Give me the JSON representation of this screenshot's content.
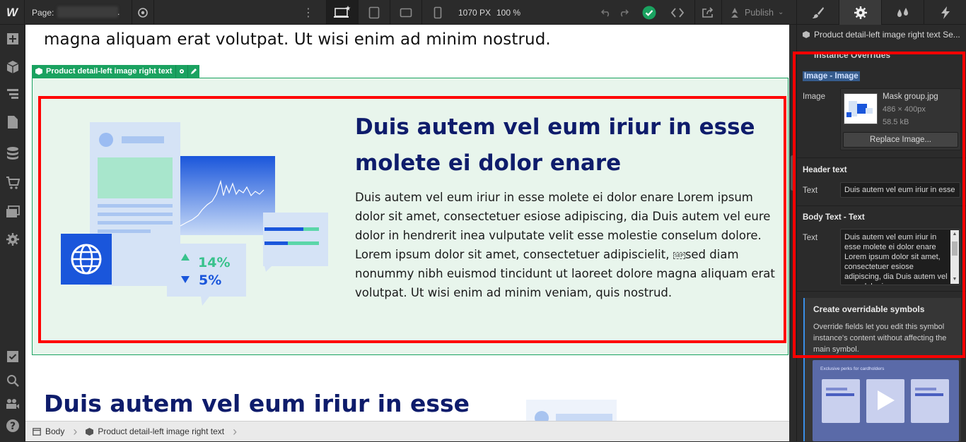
{
  "topbar": {
    "logo": "W",
    "page_label": "Page:",
    "page_name_dot": ".",
    "width_readout": "1070 PX",
    "zoom_readout": "100 %",
    "publish_label": "Publish"
  },
  "canvas": {
    "top_text": "magna aliquam erat volutpat. Ut wisi enim ad minim nostrud.",
    "symbol_tag": "Product detail-left image right text",
    "headline": "Duis autem vel eum iriur in esse molete ei dolor enare",
    "body_before_sep": "Duis autem vel eum iriur in esse molete ei dolor enare Lorem ipsum dolor sit amet, consectetuer esiose adipiscing,  dia Duis autem vel eure dolor in hendrerit inea vulputate velit esse molestie conselum dolore. Lorem ipsum dolor sit amet, consectetuer adipiscielit,",
    "sep_glyph": "SEP",
    "body_after_sep": "sed diam nonummy nibh euismod tincidunt ut laoreet dolore magna aliquam erat volutpat. Ut wisi enim ad minim veniam, quis nostrud.",
    "stat_up": "14%",
    "stat_down": "5%",
    "second_headline": "Duis autem vel eum iriur in esse"
  },
  "breadcrumb": {
    "items": [
      "Body",
      "Product detail-left image right text"
    ]
  },
  "panel": {
    "selection_title": "Product detail-left image right text Se...",
    "instance_overrides": "Instance Overrides",
    "image_section_title": "Image - Image",
    "image_label": "Image",
    "image_filename": "Mask group.jpg",
    "image_dims": "486 × 400px",
    "image_size": "58.5 kB",
    "replace_button": "Replace Image...",
    "header_section_title": "Header text",
    "header_text_label": "Text",
    "header_text_value": "Duis autem vel eum iriur in esse",
    "body_section_title": "Body Text - Text",
    "body_text_label": "Text",
    "body_text_value": "Duis autem vel eum iriur in esse molete ei dolor enare Lorem ipsum dolor sit amet, consectetuer esiose adipiscing,  dia Duis autem vel eure dolor in",
    "info_title": "Create overridable symbols",
    "info_desc": "Override fields let you edit this symbol instance's content without affecting the main symbol.",
    "video_caption": "Exclusive perks for cardholders"
  },
  "colors": {
    "selection_green": "#1aa260",
    "highlight_red": "#ff0000",
    "headline_navy": "#0e1c6b",
    "panel_bg": "#2b2b2b",
    "status_ok": "#1aa260"
  },
  "icons": {
    "left_toolbar": [
      "add-icon",
      "symbols-icon",
      "navigator-icon",
      "pages-icon",
      "cms-icon",
      "ecommerce-icon",
      "assets-icon",
      "settings-icon",
      "tasks-icon",
      "search-icon",
      "audit-icon",
      "help-icon"
    ],
    "panel_tabs": [
      "style-brush-icon",
      "settings-gear-icon",
      "interactions-drops-icon",
      "lightning-icon"
    ]
  }
}
